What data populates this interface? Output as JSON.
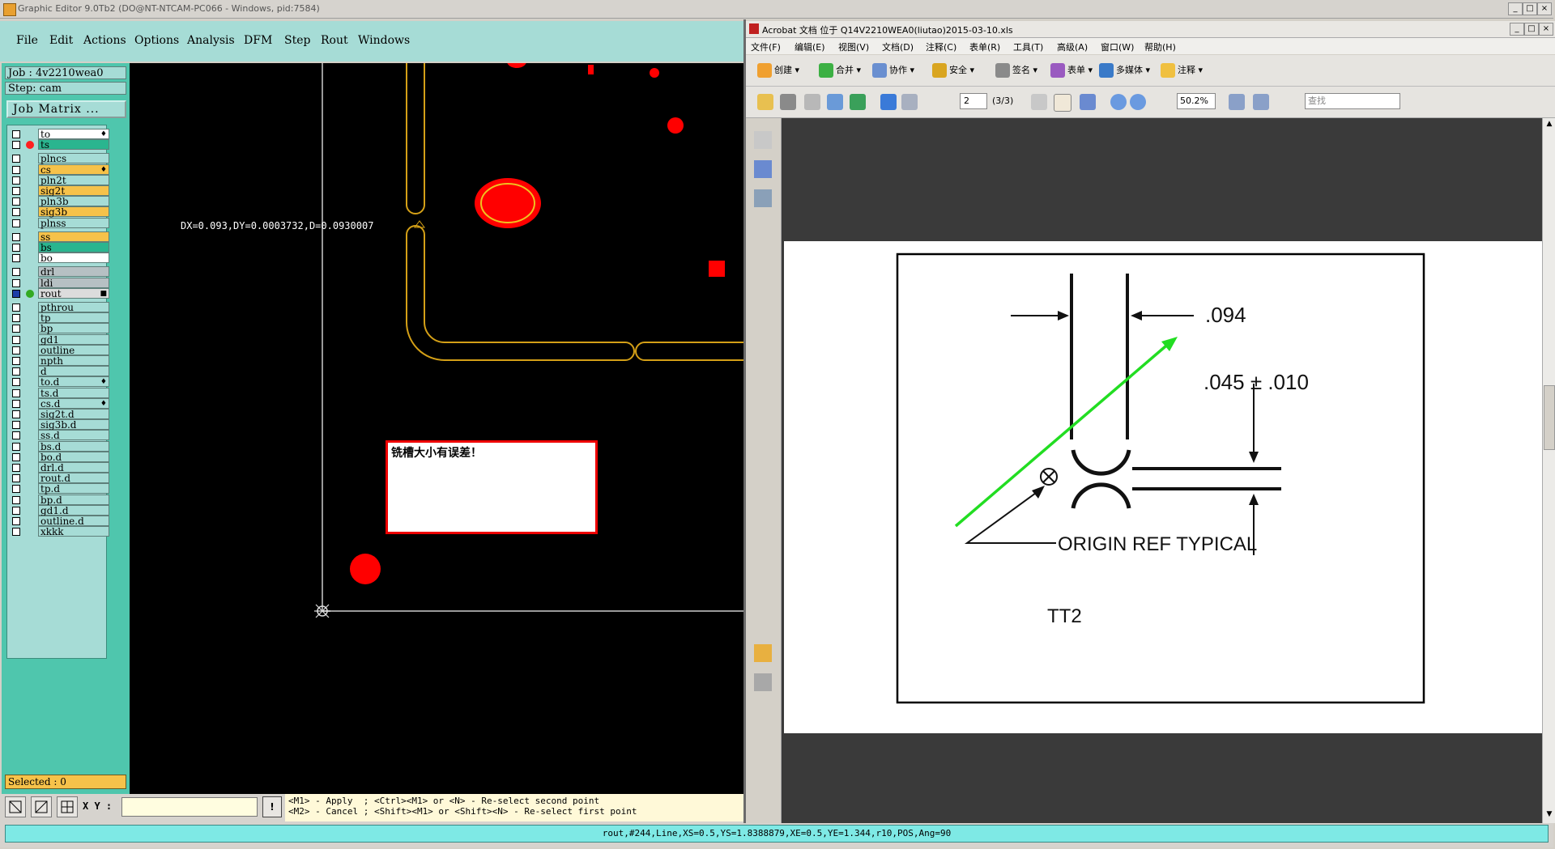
{
  "ge": {
    "title": "Graphic Editor 9.0Tb2 (DO@NT-NTCAM-PC066 - Windows, pid:7584)",
    "menu": [
      "File",
      "Edit",
      "Actions",
      "Options",
      "Analysis",
      "DFM",
      "Step",
      "Rout",
      "Windows"
    ],
    "job": "Job : 4v2210wea0",
    "step": "Step: cam",
    "job_matrix": "Job Matrix ...",
    "layers": [
      {
        "name": "to",
        "color": "white",
        "tag": "♦",
        "dot": ""
      },
      {
        "name": "ts",
        "color": "green",
        "tag": "",
        "dot": "#ff2020"
      },
      {
        "name": "plncs",
        "color": "base",
        "tag": "",
        "dot": ""
      },
      {
        "name": "cs",
        "color": "orange",
        "tag": "♦",
        "dot": ""
      },
      {
        "name": "pln2t",
        "color": "base",
        "tag": "",
        "dot": ""
      },
      {
        "name": "sig2t",
        "color": "orange",
        "tag": "",
        "dot": ""
      },
      {
        "name": "pln3b",
        "color": "base",
        "tag": "",
        "dot": ""
      },
      {
        "name": "sig3b",
        "color": "orange",
        "tag": "",
        "dot": ""
      },
      {
        "name": "plnss",
        "color": "base",
        "tag": "",
        "dot": ""
      },
      {
        "name": "ss",
        "color": "orange",
        "tag": "",
        "dot": ""
      },
      {
        "name": "bs",
        "color": "green",
        "tag": "",
        "dot": ""
      },
      {
        "name": "bo",
        "color": "white",
        "tag": "",
        "dot": ""
      },
      {
        "name": "drl",
        "color": "gray",
        "tag": "",
        "dot": ""
      },
      {
        "name": "ldi",
        "color": "gray",
        "tag": "",
        "dot": ""
      },
      {
        "name": "rout",
        "color": "light",
        "tag": "■",
        "dot": "#33aa22",
        "checked": true
      },
      {
        "name": "pthrou",
        "color": "base",
        "tag": "",
        "dot": ""
      },
      {
        "name": "tp",
        "color": "base",
        "tag": "",
        "dot": ""
      },
      {
        "name": "bp",
        "color": "base",
        "tag": "",
        "dot": ""
      },
      {
        "name": "gd1",
        "color": "base",
        "tag": "",
        "dot": ""
      },
      {
        "name": "outline",
        "color": "base",
        "tag": "",
        "dot": ""
      },
      {
        "name": "npth",
        "color": "base",
        "tag": "",
        "dot": ""
      },
      {
        "name": "d",
        "color": "base",
        "tag": "",
        "dot": ""
      },
      {
        "name": "to.d",
        "color": "base",
        "tag": "♦",
        "dot": ""
      },
      {
        "name": "ts.d",
        "color": "base",
        "tag": "",
        "dot": ""
      },
      {
        "name": "cs.d",
        "color": "base",
        "tag": "♦",
        "dot": ""
      },
      {
        "name": "sig2t.d",
        "color": "base",
        "tag": "",
        "dot": ""
      },
      {
        "name": "sig3b.d",
        "color": "base",
        "tag": "",
        "dot": ""
      },
      {
        "name": "ss.d",
        "color": "base",
        "tag": "",
        "dot": ""
      },
      {
        "name": "bs.d",
        "color": "base",
        "tag": "",
        "dot": ""
      },
      {
        "name": "bo.d",
        "color": "base",
        "tag": "",
        "dot": ""
      },
      {
        "name": "drl.d",
        "color": "base",
        "tag": "",
        "dot": ""
      },
      {
        "name": "rout.d",
        "color": "base",
        "tag": "",
        "dot": ""
      },
      {
        "name": "tp.d",
        "color": "base",
        "tag": "",
        "dot": ""
      },
      {
        "name": "bp.d",
        "color": "base",
        "tag": "",
        "dot": ""
      },
      {
        "name": "gd1.d",
        "color": "base",
        "tag": "",
        "dot": ""
      },
      {
        "name": "outline.d",
        "color": "base",
        "tag": "",
        "dot": ""
      },
      {
        "name": "xkkk",
        "color": "base",
        "tag": "",
        "dot": ""
      }
    ],
    "selected": "Selected : 0",
    "measure": "DX=0.093,DY=0.0003732,D=0.0930007",
    "error_message": "铣槽大小有误差！",
    "xy_label": "X Y :",
    "xy_value": "",
    "excl": "!",
    "hint_line1": "<M1> - Apply  ; <Ctrl><M1> or <N> - Re-select second point",
    "hint_line2": "<M2> - Cancel ; <Shift><M1> or <Shift><N> - Re-select first point",
    "status": "rout,#244,Line,XS=0.5,YS=1.8388879,XE=0.5,YE=1.344,r10,POS,Ang=90"
  },
  "acro": {
    "title": "Acrobat 文档 位于 Q14V2210WEA0(liutao)2015-03-10.xls",
    "menu": [
      "文件(F)",
      "编辑(E)",
      "视图(V)",
      "文档(D)",
      "注释(C)",
      "表单(R)",
      "工具(T)",
      "高级(A)",
      "窗口(W)",
      "帮助(H)"
    ],
    "toolbar1": [
      "创建",
      "合并",
      "协作",
      "安全",
      "签名",
      "表单",
      "多媒体",
      "注释"
    ],
    "page_num": "2",
    "page_count": "(3/3)",
    "zoom": "50.2%",
    "search_placeholder": "查找",
    "drawing": {
      "dim1": ".094",
      "dim2": ".045 ± .010",
      "origin_label": "ORIGIN REF TYPICAL",
      "tag": "TT2"
    }
  },
  "colors": {
    "ge_menu_bg": "#a6dcd6",
    "ge_sidebar": "#4fc6ad",
    "rout_outline": "#d4a017",
    "pad_red": "#ff0000",
    "arrow_green": "#22dd22",
    "status_cyan": "#7ee9e5"
  }
}
